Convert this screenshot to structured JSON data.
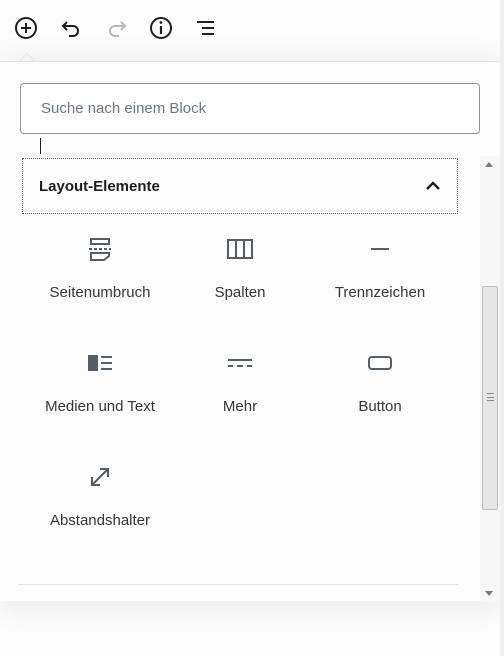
{
  "toolbar": {
    "buttons": [
      {
        "icon": "plus-circle-icon"
      },
      {
        "icon": "undo-icon"
      },
      {
        "icon": "redo-icon"
      },
      {
        "icon": "info-icon"
      },
      {
        "icon": "list-outline-icon"
      }
    ]
  },
  "inserter": {
    "search": {
      "placeholder": "Suche nach einem Block",
      "value": ""
    },
    "panel": {
      "title": "Layout-Elemente",
      "expanded": true
    },
    "blocks": [
      {
        "label": "Seitenumbruch",
        "icon": "page-break-icon"
      },
      {
        "label": "Spalten",
        "icon": "columns-icon"
      },
      {
        "label": "Trennzeichen",
        "icon": "separator-icon"
      },
      {
        "label": "Medien und Text",
        "icon": "media-text-icon"
      },
      {
        "label": "Mehr",
        "icon": "more-icon"
      },
      {
        "label": "Button",
        "icon": "button-icon"
      },
      {
        "label": "Abstandshalter",
        "icon": "spacer-icon"
      }
    ]
  },
  "colors": {
    "icon": "#555d66",
    "text": "#32373c",
    "border": "#8d96a0"
  }
}
